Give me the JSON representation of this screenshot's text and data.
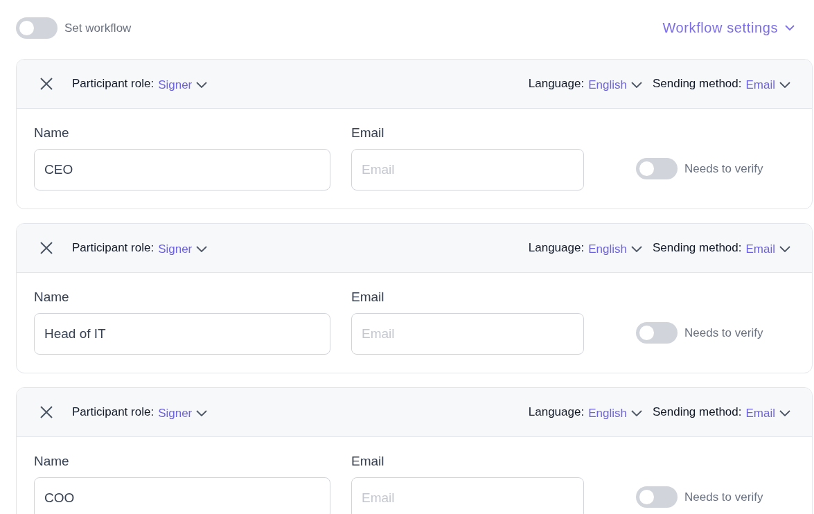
{
  "workflow_toggle": {
    "label": "Set workflow",
    "on": false
  },
  "workflow_settings": {
    "label": "Workflow settings"
  },
  "participants": [
    {
      "role_label": "Participant role:",
      "role": "Signer",
      "language_label": "Language:",
      "language": "English",
      "sending_label": "Sending method:",
      "sending": "Email",
      "name_label": "Name",
      "name_value": "CEO",
      "email_label": "Email",
      "email_placeholder": "Email",
      "verify_label": "Needs to verify",
      "verify_on": false
    },
    {
      "role_label": "Participant role:",
      "role": "Signer",
      "language_label": "Language:",
      "language": "English",
      "sending_label": "Sending method:",
      "sending": "Email",
      "name_label": "Name",
      "name_value": "Head of IT",
      "email_label": "Email",
      "email_placeholder": "Email",
      "verify_label": "Needs to verify",
      "verify_on": false
    },
    {
      "role_label": "Participant role:",
      "role": "Signer",
      "language_label": "Language:",
      "language": "English",
      "sending_label": "Sending method:",
      "sending": "Email",
      "name_label": "Name",
      "name_value": "COO",
      "email_label": "Email",
      "email_placeholder": "Email",
      "verify_label": "Needs to verify",
      "verify_on": false
    }
  ]
}
